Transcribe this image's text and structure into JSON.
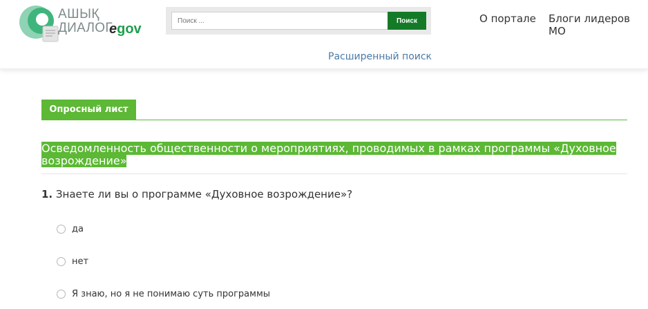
{
  "logo": {
    "line1": "АШЫҚ",
    "line2": "ДИАЛОГ",
    "egov_e": "e",
    "egov_rest": "gov",
    "brand_color": "#1d9e4f"
  },
  "search": {
    "placeholder": "Поиск ...",
    "button_label": "Поиск",
    "advanced_label": "Расширенный поиск"
  },
  "nav": {
    "items": [
      {
        "label": "О портале"
      },
      {
        "label": "Блоги лидеров МО"
      }
    ]
  },
  "tabs": {
    "active_label": "Опросный лист",
    "accent_color": "#5cb835"
  },
  "survey": {
    "title": "Осведомленность общественности о мероприятиях, проводимых в рамках программы «Духовное возрождение»",
    "question": {
      "number": "1.",
      "text": "Знаете ли вы о программе «Духовное возрождение»?",
      "options": [
        {
          "label": "да"
        },
        {
          "label": "нет"
        },
        {
          "label": "Я знаю, но я не понимаю суть программы"
        }
      ]
    }
  }
}
